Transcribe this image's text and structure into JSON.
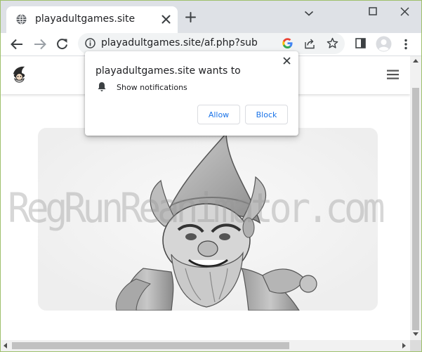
{
  "browser": {
    "tab": {
      "title": "playadultgames.site"
    },
    "address_bar": {
      "url": "playadultgames.site/af.php?sub=("
    }
  },
  "permission_prompt": {
    "title": "playadultgames.site wants to",
    "permission": "Show notifications",
    "allow_label": "Allow",
    "block_label": "Block"
  },
  "page": {
    "watermark": "RegRunReanimator.com"
  },
  "colors": {
    "accent": "#1a73e8",
    "frame_border": "#9ec06c"
  }
}
